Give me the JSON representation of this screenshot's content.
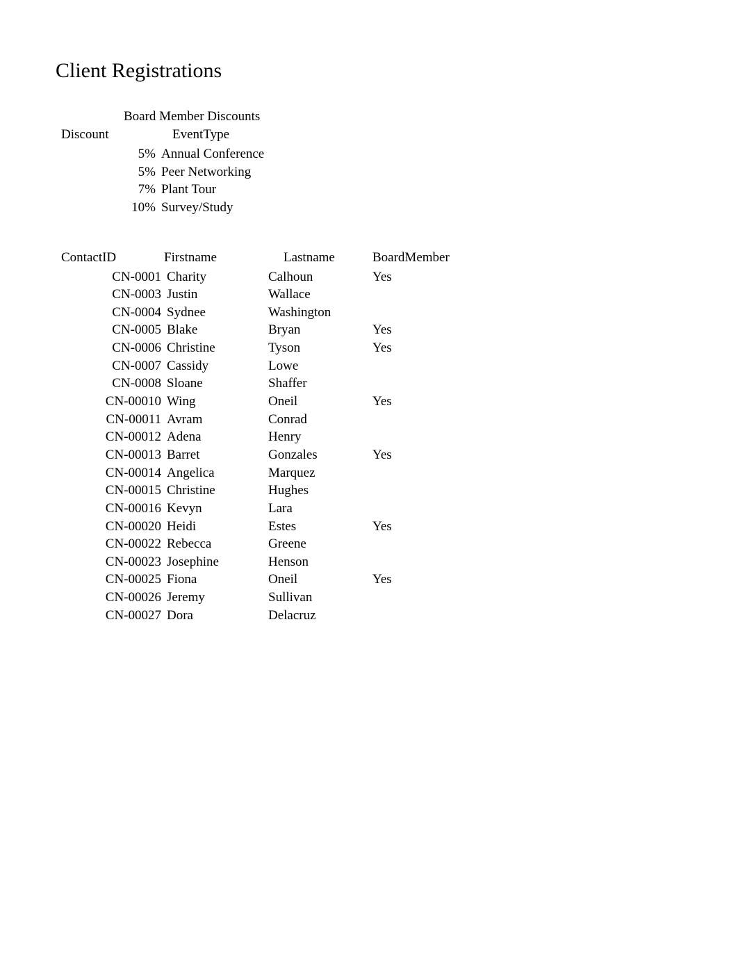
{
  "title": "Client Registrations",
  "discounts": {
    "title": "Board Member Discounts",
    "headers": {
      "discount": "Discount",
      "eventType": "EventType"
    },
    "rows": [
      {
        "discount": "5%",
        "event": "Annual Conference"
      },
      {
        "discount": "5%",
        "event": "Peer Networking"
      },
      {
        "discount": "7%",
        "event": "Plant Tour"
      },
      {
        "discount": "10%",
        "event": "Survey/Study"
      }
    ]
  },
  "contacts": {
    "headers": {
      "contactId": "ContactID",
      "firstname": "Firstname",
      "lastname": "Lastname",
      "boardMember": "BoardMember"
    },
    "rows": [
      {
        "contactId": "CN-0001",
        "firstname": "Charity",
        "lastname": "Calhoun",
        "boardMember": "Yes"
      },
      {
        "contactId": "CN-0003",
        "firstname": "Justin",
        "lastname": "Wallace",
        "boardMember": ""
      },
      {
        "contactId": "CN-0004",
        "firstname": "Sydnee",
        "lastname": "Washington",
        "boardMember": ""
      },
      {
        "contactId": "CN-0005",
        "firstname": "Blake",
        "lastname": "Bryan",
        "boardMember": "Yes"
      },
      {
        "contactId": "CN-0006",
        "firstname": "Christine",
        "lastname": "Tyson",
        "boardMember": "Yes"
      },
      {
        "contactId": "CN-0007",
        "firstname": "Cassidy",
        "lastname": "Lowe",
        "boardMember": ""
      },
      {
        "contactId": "CN-0008",
        "firstname": "Sloane",
        "lastname": "Shaffer",
        "boardMember": ""
      },
      {
        "contactId": "CN-00010",
        "firstname": "Wing",
        "lastname": "Oneil",
        "boardMember": "Yes"
      },
      {
        "contactId": "CN-00011",
        "firstname": "Avram",
        "lastname": "Conrad",
        "boardMember": ""
      },
      {
        "contactId": "CN-00012",
        "firstname": "Adena",
        "lastname": "Henry",
        "boardMember": ""
      },
      {
        "contactId": "CN-00013",
        "firstname": "Barret",
        "lastname": "Gonzales",
        "boardMember": "Yes"
      },
      {
        "contactId": "CN-00014",
        "firstname": "Angelica",
        "lastname": "Marquez",
        "boardMember": ""
      },
      {
        "contactId": "CN-00015",
        "firstname": "Christine",
        "lastname": "Hughes",
        "boardMember": ""
      },
      {
        "contactId": "CN-00016",
        "firstname": "Kevyn",
        "lastname": "Lara",
        "boardMember": ""
      },
      {
        "contactId": "CN-00020",
        "firstname": "Heidi",
        "lastname": "Estes",
        "boardMember": "Yes"
      },
      {
        "contactId": "CN-00022",
        "firstname": "Rebecca",
        "lastname": "Greene",
        "boardMember": ""
      },
      {
        "contactId": "CN-00023",
        "firstname": "Josephine",
        "lastname": "Henson",
        "boardMember": ""
      },
      {
        "contactId": "CN-00025",
        "firstname": "Fiona",
        "lastname": "Oneil",
        "boardMember": "Yes"
      },
      {
        "contactId": "CN-00026",
        "firstname": "Jeremy",
        "lastname": "Sullivan",
        "boardMember": ""
      },
      {
        "contactId": "CN-00027",
        "firstname": "Dora",
        "lastname": "Delacruz",
        "boardMember": ""
      }
    ]
  }
}
